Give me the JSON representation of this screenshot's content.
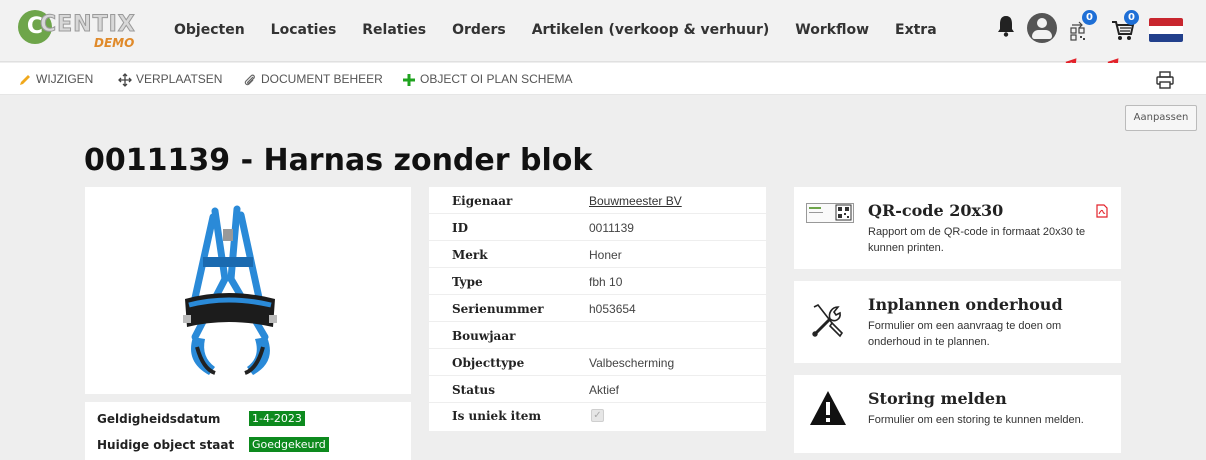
{
  "logo": {
    "text": "CENTIX",
    "demo": "DEMO"
  },
  "menu": [
    "Objecten",
    "Locaties",
    "Relaties",
    "Orders",
    "Artikelen (verkoop & verhuur)",
    "Workflow",
    "Extra"
  ],
  "badges": {
    "qr_count": "0",
    "cart_count": "0"
  },
  "toolbar": {
    "edit": "WIJZIGEN",
    "move": "VERPLAATSEN",
    "docs": "DOCUMENT BEHEER",
    "plan": "OBJECT OI PLAN SCHEMA"
  },
  "aanpassen": "Aanpassen",
  "title": "0011139 - Harnas zonder blok",
  "details": [
    {
      "label": "Eigenaar",
      "value": "Bouwmeester BV"
    },
    {
      "label": "ID",
      "value": "0011139"
    },
    {
      "label": "Merk",
      "value": "Honer"
    },
    {
      "label": "Type",
      "value": "fbh 10"
    },
    {
      "label": "Serienummer",
      "value": "h053654"
    },
    {
      "label": "Bouwjaar",
      "value": ""
    },
    {
      "label": "Objecttype",
      "value": "Valbescherming"
    },
    {
      "label": "Status",
      "value": "Aktief"
    },
    {
      "label": "Is uniek item",
      "value": ""
    }
  ],
  "validity": {
    "date_label": "Geldigheidsdatum",
    "date_value": "1-4-2023",
    "state_label": "Huidige object staat",
    "state_value": "Goedgekeurd"
  },
  "cards": {
    "qr": {
      "title": "QR-code 20x30",
      "desc": "Rapport om de QR-code in formaat 20x30 te kunnen printen."
    },
    "maintenance": {
      "title": "Inplannen onderhoud",
      "desc": "Formulier om een aanvraag te doen om onderhoud in te plannen."
    },
    "fault": {
      "title": "Storing melden",
      "desc": "Formulier om een storing te kunnen melden."
    }
  },
  "colors": {
    "accent_green": "#0d8a1e",
    "badge_blue": "#1e6fd6",
    "arrow_red": "#e3222a",
    "harness_blue": "#2a8ad8"
  }
}
